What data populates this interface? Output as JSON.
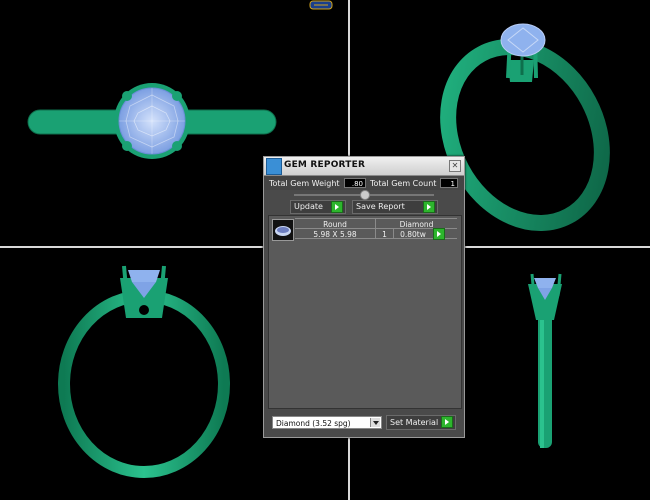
{
  "colors": {
    "ring": "#1aa173",
    "ring_dark": "#0e6f4c",
    "gem": "#8fb2ee",
    "gem_light": "#d3e1fb",
    "background": "#000000",
    "accent_button": "#2db52d"
  },
  "viewports": [
    {
      "view": "top",
      "icon": "ring-top-view"
    },
    {
      "view": "perspective",
      "icon": "ring-perspective-view"
    },
    {
      "view": "front",
      "icon": "ring-front-view"
    },
    {
      "view": "side",
      "icon": "ring-side-view"
    }
  ],
  "gem_reporter": {
    "title": "GEM REPORTER",
    "close_icon": "close-icon",
    "total_weight_label": "Total Gem Weight",
    "total_weight_value": ".80",
    "total_count_label": "Total Gem Count",
    "total_count_value": "1",
    "update_label": "Update",
    "save_report_label": "Save Report",
    "table": {
      "headers": [
        "Round",
        "Diamond"
      ],
      "rows": [
        {
          "shape": "Round",
          "size": "5.98 X 5.98",
          "material": "Diamond",
          "count": "1",
          "weight": "0.80tw"
        }
      ]
    },
    "material_select": {
      "selected": "Diamond   (3.52 spg)"
    },
    "set_material_label": "Set Material"
  }
}
